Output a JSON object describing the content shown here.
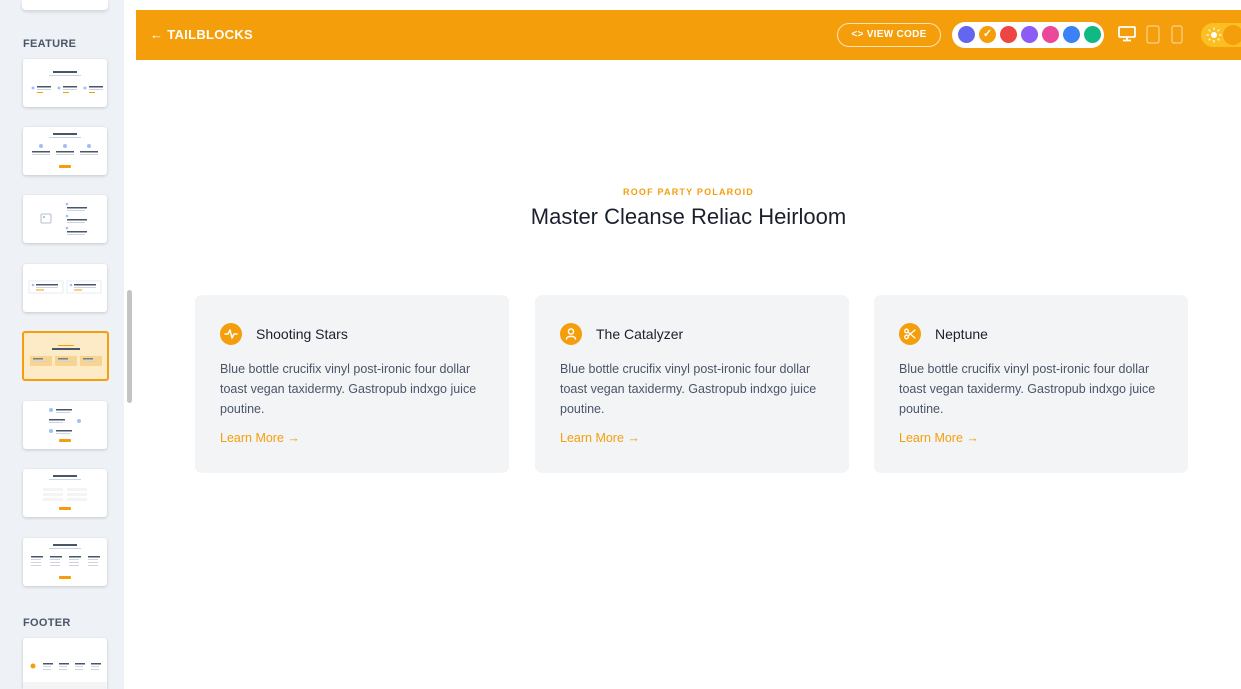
{
  "sidebar": {
    "sections": [
      {
        "label": "FEATURE"
      },
      {
        "label": "FOOTER"
      }
    ]
  },
  "header": {
    "back_label": "← TAILBLOCKS",
    "view_code_label": "<> VIEW CODE",
    "swatches": [
      {
        "name": "indigo",
        "color": "#6366f1",
        "selected": false
      },
      {
        "name": "yellow",
        "color": "#f59e0b",
        "selected": true
      },
      {
        "name": "red",
        "color": "#ef4444",
        "selected": false
      },
      {
        "name": "purple",
        "color": "#8b5cf6",
        "selected": false
      },
      {
        "name": "pink",
        "color": "#ec4899",
        "selected": false
      },
      {
        "name": "blue",
        "color": "#3b82f6",
        "selected": false
      },
      {
        "name": "green",
        "color": "#10b981",
        "selected": false
      }
    ],
    "accent_color": "#f59e0b"
  },
  "main": {
    "subtitle": "ROOF PARTY POLAROID",
    "title": "Master Cleanse Reliac Heirloom",
    "cards": [
      {
        "icon": "pulse-icon",
        "title": "Shooting Stars",
        "text": "Blue bottle crucifix vinyl post-ironic four dollar toast vegan taxidermy. Gastropub indxgo juice poutine.",
        "link": "Learn More →"
      },
      {
        "icon": "user-icon",
        "title": "The Catalyzer",
        "text": "Blue bottle crucifix vinyl post-ironic four dollar toast vegan taxidermy. Gastropub indxgo juice poutine.",
        "link": "Learn More →"
      },
      {
        "icon": "scissors-icon",
        "title": "Neptune",
        "text": "Blue bottle crucifix vinyl post-ironic four dollar toast vegan taxidermy. Gastropub indxgo juice poutine.",
        "link": "Learn More →"
      }
    ]
  }
}
